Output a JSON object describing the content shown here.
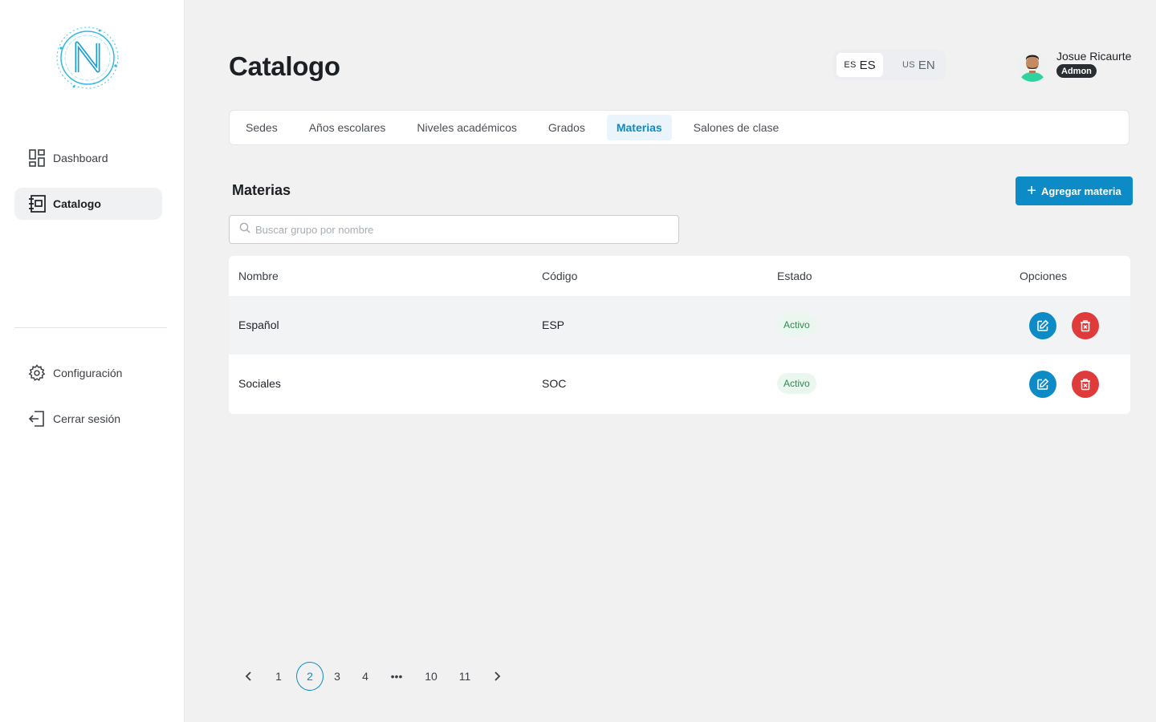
{
  "sidebar": {
    "items": [
      {
        "label": "Dashboard",
        "icon": "dashboard-icon"
      },
      {
        "label": "Catalogo",
        "icon": "catalog-icon",
        "active": true
      }
    ],
    "bottom_items": [
      {
        "label": "Configuración",
        "icon": "gear-icon"
      },
      {
        "label": "Cerrar sesión",
        "icon": "logout-icon"
      }
    ]
  },
  "header": {
    "title": "Catalogo",
    "languages": [
      {
        "flag": "ES",
        "code": "ES",
        "active": true
      },
      {
        "flag": "US",
        "code": "EN",
        "active": false
      }
    ],
    "user": {
      "name": "Josue Ricaurte",
      "role": "Admon"
    }
  },
  "tabs": [
    {
      "label": "Sedes"
    },
    {
      "label": "Años escolares"
    },
    {
      "label": "Niveles académicos"
    },
    {
      "label": "Grados"
    },
    {
      "label": "Materias",
      "active": true
    },
    {
      "label": "Salones de clase"
    }
  ],
  "section": {
    "title": "Materias",
    "add_label": "Agregar materia",
    "search_placeholder": "Buscar grupo por nombre"
  },
  "table": {
    "columns": [
      "Nombre",
      "Código",
      "Estado",
      "Opciones"
    ],
    "rows": [
      {
        "nombre": "Español",
        "codigo": "ESP",
        "estado": "Activo"
      },
      {
        "nombre": "Sociales",
        "codigo": "SOC",
        "estado": "Activo"
      }
    ]
  },
  "pagination": {
    "pages": [
      "1",
      "2",
      "3",
      "4",
      "•••",
      "10",
      "11"
    ],
    "current": "2"
  },
  "colors": {
    "accent": "#0d8bc7",
    "danger": "#e03b3b",
    "success_text": "#2e8b4f",
    "success_bg": "#eaf7ef"
  }
}
